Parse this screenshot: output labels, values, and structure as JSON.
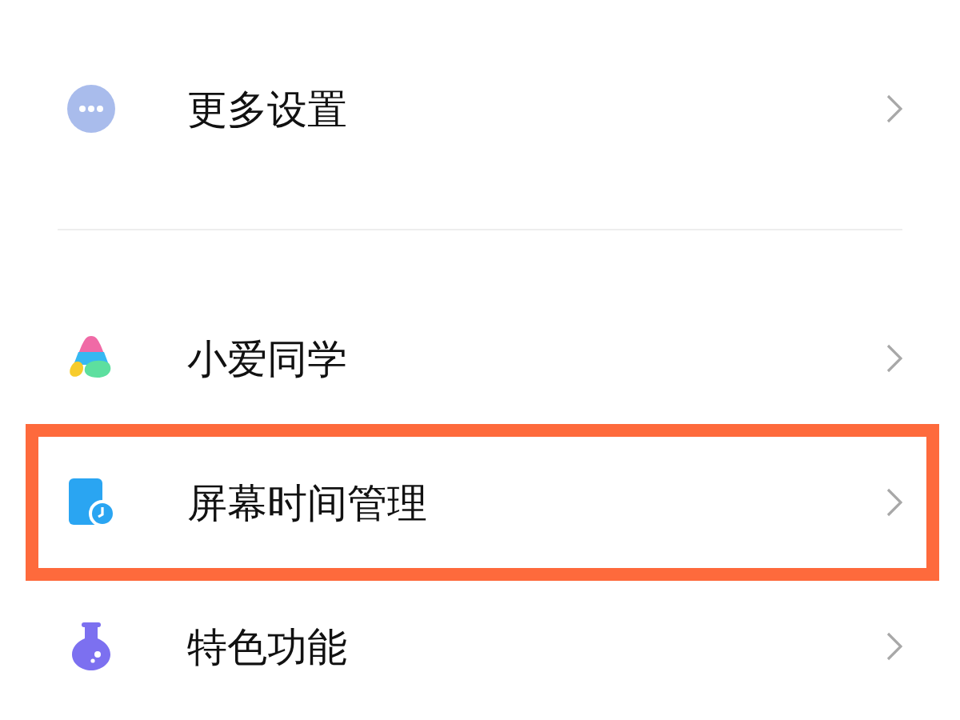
{
  "groups": [
    {
      "items": [
        {
          "label": "更多设置",
          "kind": "more",
          "highlighted": false
        }
      ]
    },
    {
      "items": [
        {
          "label": "小爱同学",
          "kind": "assistant",
          "highlighted": false
        },
        {
          "label": "屏幕时间管理",
          "kind": "screentime",
          "highlighted": true
        },
        {
          "label": "特色功能",
          "kind": "flask",
          "highlighted": false
        }
      ]
    }
  ]
}
